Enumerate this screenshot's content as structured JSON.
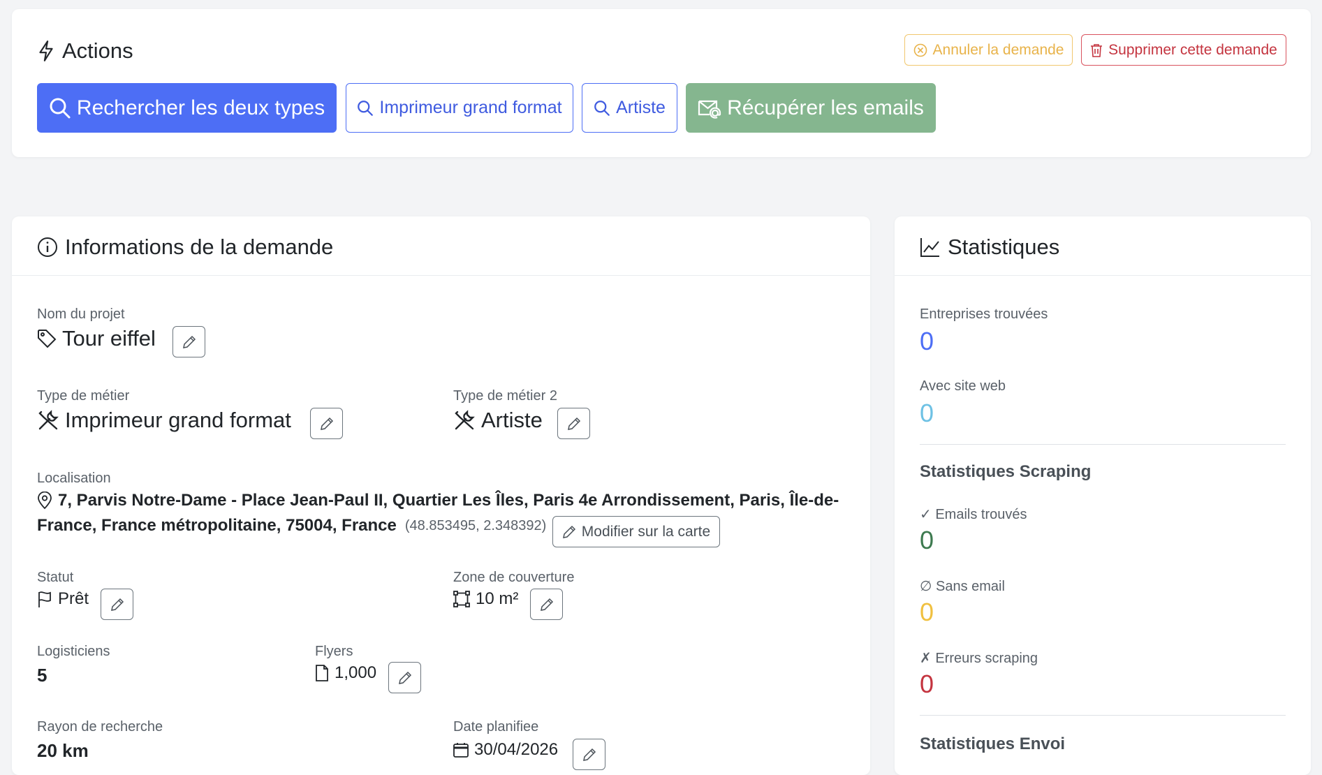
{
  "actions": {
    "title": "Actions",
    "cancel_label": "Annuler la demande",
    "delete_label": "Supprimer cette demande",
    "search_both_label": "Rechercher les deux types",
    "search_printer_label": "Imprimeur grand format",
    "search_artist_label": "Artiste",
    "fetch_emails_label": "Récupérer les emails"
  },
  "info": {
    "title": "Informations de la demande",
    "project_name_label": "Nom du projet",
    "project_name": "Tour eiffel",
    "job_type_label": "Type de métier",
    "job_type": "Imprimeur grand format",
    "job_type2_label": "Type de métier 2",
    "job_type2": "Artiste",
    "location_label": "Localisation",
    "location_line1": "7, Parvis Notre-Dame - Place Jean-Paul II, Quartier Les Îles, Paris 4e Arrondissement, Paris, Île-de-",
    "location_line2": "France, France métropolitaine, 75004, France",
    "coordinates": "(48.853495, 2.348392)",
    "edit_map_label": "Modifier sur la carte",
    "status_label": "Statut",
    "status": "Prêt",
    "coverage_label": "Zone de couverture",
    "coverage": "10 m²",
    "logisticians_label": "Logisticiens",
    "logisticians": "5",
    "flyers_label": "Flyers",
    "flyers": "1,000",
    "radius_label": "Rayon de recherche",
    "radius": "20 km",
    "planned_date_label": "Date planifiee",
    "planned_date": "30/04/2026"
  },
  "stats": {
    "title": "Statistiques",
    "companies_found_label": "Entreprises trouvées",
    "companies_found": "0",
    "with_website_label": "Avec site web",
    "with_website": "0",
    "scraping_heading": "Statistiques Scraping",
    "emails_found_label": "✓ Emails trouvés",
    "emails_found": "0",
    "no_email_label": "∅ Sans email",
    "no_email": "0",
    "scraping_errors_label": "✗ Erreurs scraping",
    "scraping_errors": "0",
    "sending_heading": "Statistiques Envoi"
  },
  "colors": {
    "primary": "#4d6ef5",
    "info": "#6ec1e4",
    "success": "#3d7a4f",
    "warning": "#f0c040",
    "danger": "#c4343f"
  }
}
